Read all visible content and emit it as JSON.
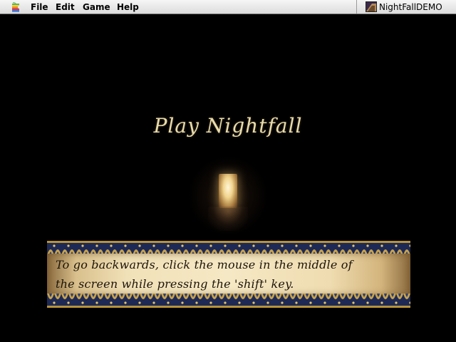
{
  "menubar": {
    "apple_icon": "apple-icon",
    "items": [
      {
        "label": "File"
      },
      {
        "label": "Edit"
      },
      {
        "label": "Game"
      },
      {
        "label": "Help"
      }
    ],
    "app_switcher": {
      "icon": "nightfall-app-icon",
      "label": "NightFallDEMO"
    }
  },
  "game": {
    "title": "Play Nightfall",
    "instruction_lines": [
      "To go backwards, click the mouse in the middle of",
      "the screen while pressing the 'shift' key."
    ]
  },
  "colors": {
    "title": "#e8dcae",
    "parchment": "#f1e1b8",
    "border_gold": "#c9a24a",
    "border_blue": "#2c3f78",
    "doorway_light": "#f1d48e"
  }
}
